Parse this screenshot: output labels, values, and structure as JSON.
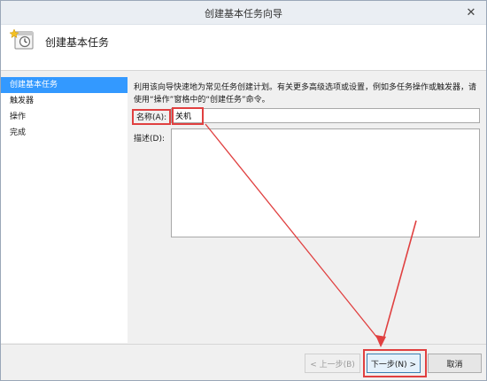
{
  "window": {
    "title": "创建基本任务向导"
  },
  "header": {
    "title": "创建基本任务",
    "icon": "task-clock-icon"
  },
  "sidebar": {
    "items": [
      {
        "label": "创建基本任务",
        "selected": true
      },
      {
        "label": "触发器",
        "selected": false
      },
      {
        "label": "操作",
        "selected": false
      },
      {
        "label": "完成",
        "selected": false
      }
    ]
  },
  "main": {
    "description": "利用该向导快速地为常见任务创建计划。有关更多高级选项或设置，例如多任务操作或触发器，请使用“操作”窗格中的“创建任务”命令。",
    "name_label": "名称(A):",
    "name_value": "关机",
    "desc_label": "描述(D):",
    "desc_value": ""
  },
  "footer": {
    "back_label": "< 上一步(B)",
    "next_label": "下一步(N) >",
    "cancel_label": "取消"
  },
  "colors": {
    "selection": "#3399ff",
    "highlight": "#e04040"
  }
}
